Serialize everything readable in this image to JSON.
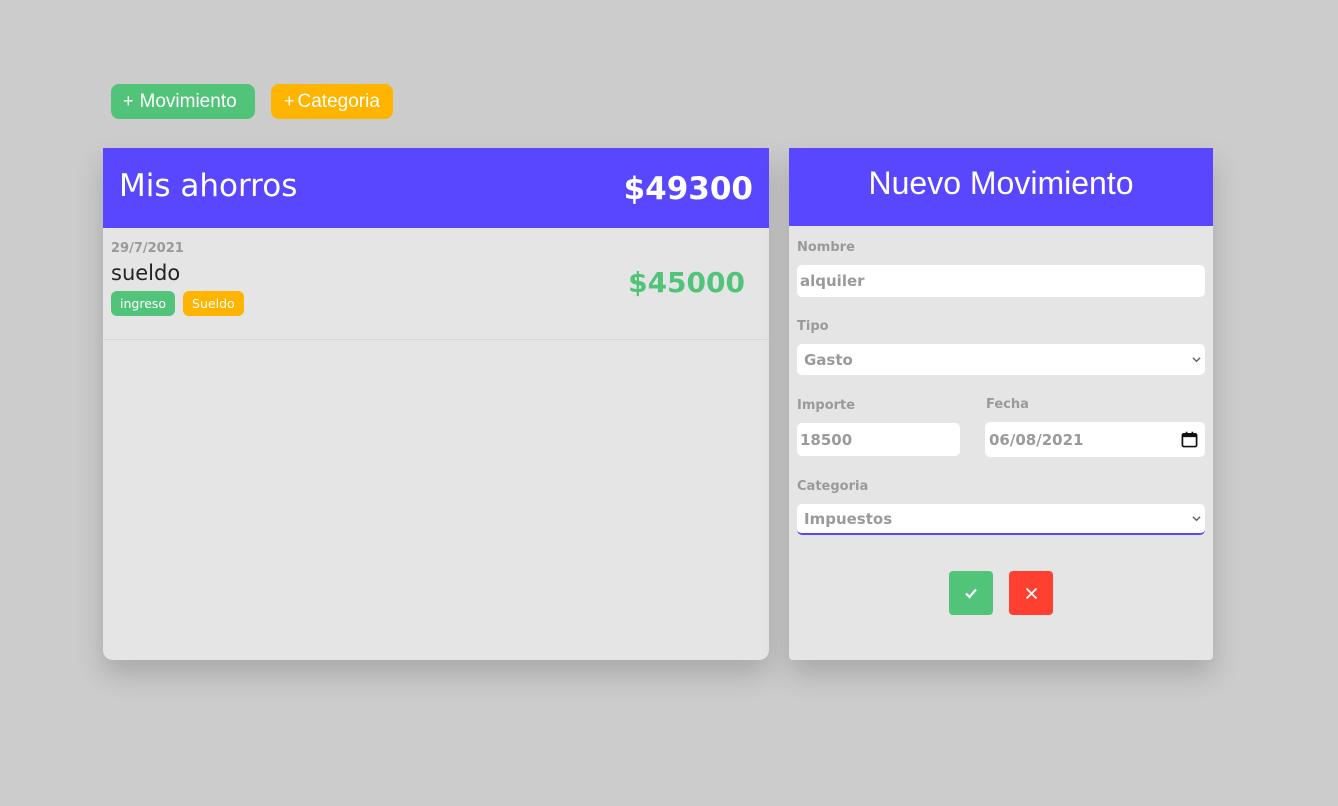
{
  "toolbar": {
    "add_movement_icon": "+",
    "add_movement_label": "Movimiento",
    "add_category_icon": "+",
    "add_category_label": "Categoria"
  },
  "savings": {
    "title": "Mis ahorros",
    "total": "$49300",
    "movements": [
      {
        "date": "29/7/2021",
        "name": "sueldo",
        "type_tag": "ingreso",
        "category_tag": "Sueldo",
        "amount": "$45000"
      }
    ]
  },
  "form": {
    "title": "Nuevo Movimiento",
    "nombre_label": "Nombre",
    "nombre_value": "alquiler",
    "tipo_label": "Tipo",
    "tipo_value": "Gasto",
    "importe_label": "Importe",
    "importe_value": "18500",
    "fecha_label": "Fecha",
    "fecha_value": "06/08/2021",
    "categoria_label": "Categoria",
    "categoria_value": "Impuestos",
    "confirm_icon": "check-icon",
    "cancel_icon": "close-icon"
  },
  "colors": {
    "background": "#cccccc",
    "header": "#5847ff",
    "income_green": "#52c47a",
    "category_yellow": "#ffb400",
    "cancel_red": "#ff3f2f",
    "card": "#e5e5e5",
    "muted_text": "#9a9a9a"
  }
}
